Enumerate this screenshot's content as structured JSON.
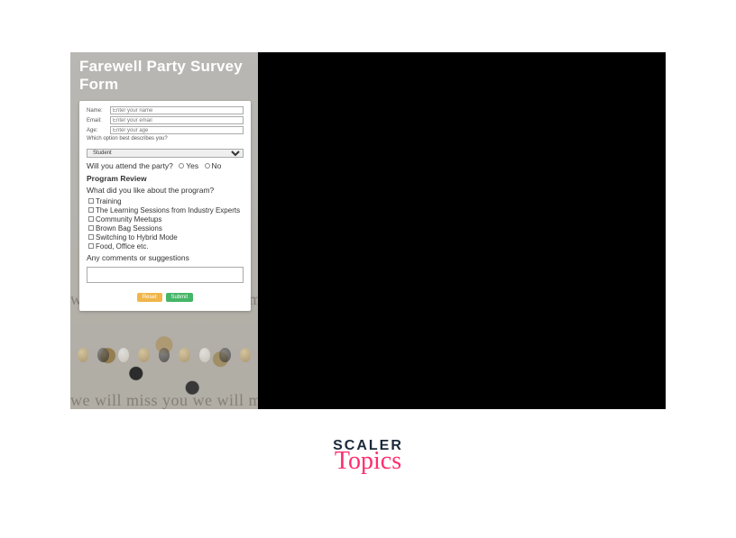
{
  "form": {
    "title": "Farewell Party Survey Form",
    "fields": {
      "name": {
        "label": "Name:",
        "placeholder": "Enter your name"
      },
      "email": {
        "label": "Email:",
        "placeholder": "Enter your email"
      },
      "age": {
        "label": "Age:",
        "placeholder": "Enter your age"
      }
    },
    "describe_label": "Which option best describes you?",
    "describe_selected": "Student",
    "attend": {
      "question": "Will you attend the party?",
      "options": [
        "Yes",
        "No"
      ]
    },
    "review_heading": "Program Review",
    "like_question": "What did you like about the program?",
    "like_options": [
      "Training",
      "The Learning Sessions from Industry Experts",
      "Community Meetups",
      "Brown Bag Sessions",
      "Switching to Hybrid Mode",
      "Food, Office etc."
    ],
    "comments_label": "Any comments or suggestions",
    "buttons": {
      "reset": "Reset",
      "submit": "Submit"
    }
  },
  "bg_script": "we will miss you   we will miss you   we will",
  "footer": {
    "line1": "SCALER",
    "line2": "Topics"
  }
}
